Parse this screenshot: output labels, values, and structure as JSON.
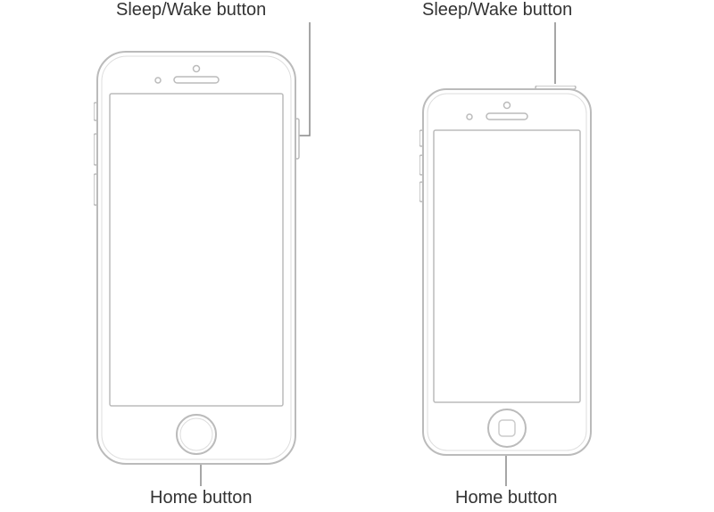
{
  "phones": [
    {
      "sleep_wake_label": "Sleep/Wake button",
      "home_button_label": "Home button"
    },
    {
      "sleep_wake_label": "Sleep/Wake button",
      "home_button_label": "Home button"
    }
  ]
}
